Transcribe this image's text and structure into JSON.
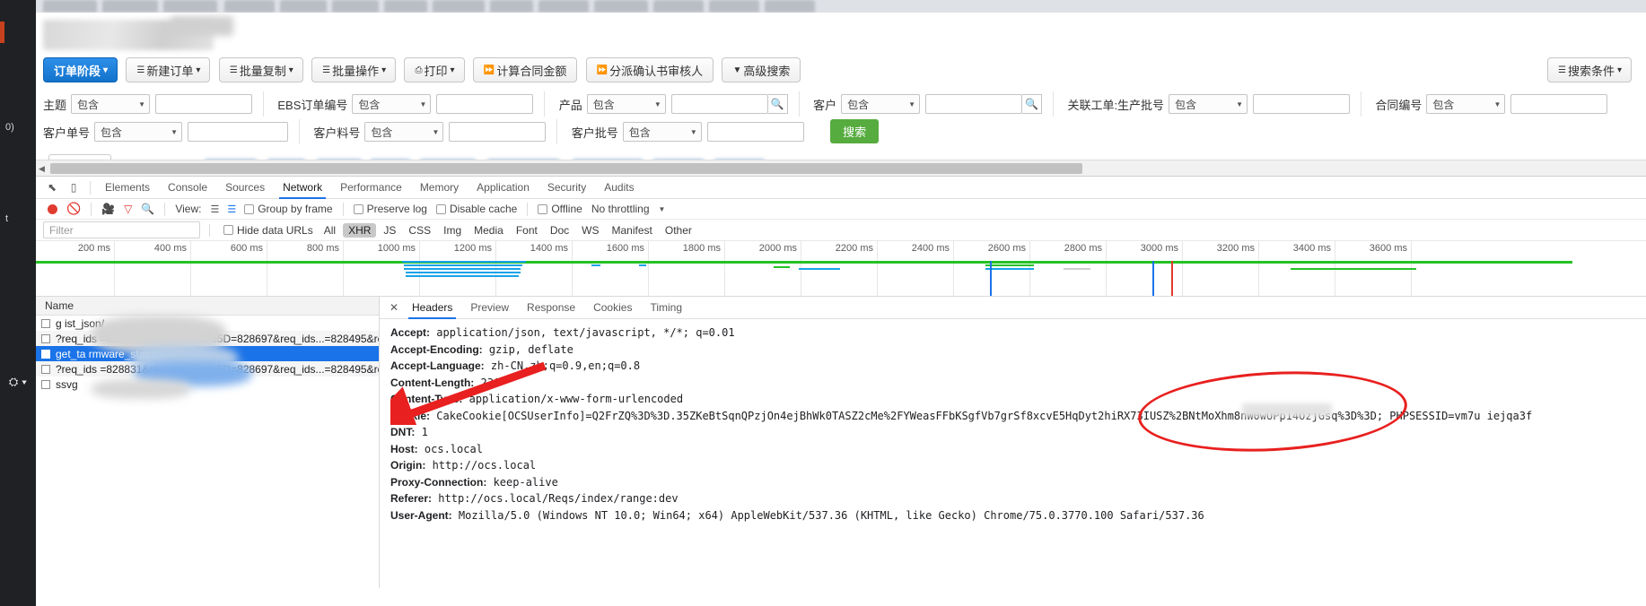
{
  "browser": {
    "tabs_blurred_count": 12
  },
  "app": {
    "toolbar_buttons": [
      {
        "label": "订单阶段",
        "icon": "chevron-down-icon",
        "primary": true
      },
      {
        "label": "新建订单",
        "icon": "list-icon",
        "primary": false
      },
      {
        "label": "批量复制",
        "icon": "list-icon",
        "primary": false
      },
      {
        "label": "批量操作",
        "icon": "list-icon",
        "primary": false
      },
      {
        "label": "打印",
        "icon": "printer-icon",
        "primary": false
      },
      {
        "label": "计算合同金额",
        "icon": "double-chevron-icon",
        "primary": false
      },
      {
        "label": "分派确认书审核人",
        "icon": "double-chevron-icon",
        "primary": false
      },
      {
        "label": "高级搜索",
        "icon": "funnel-icon",
        "primary": false
      }
    ],
    "search_conditions_label": "搜索条件",
    "search_button_label": "搜索",
    "filter_row_1": [
      {
        "label": "主题",
        "operator": "包含",
        "value": "",
        "has_magnifier": false
      },
      {
        "label": "EBS订单编号",
        "operator": "包含",
        "value": "",
        "has_magnifier": false
      },
      {
        "label": "产品",
        "operator": "包含",
        "value": "",
        "has_magnifier": true
      },
      {
        "label": "客户",
        "operator": "包含",
        "value": "",
        "has_magnifier": true
      },
      {
        "label": "关联工单:生产批号",
        "operator": "包含",
        "value": "",
        "has_magnifier": false
      },
      {
        "label": "合同编号",
        "operator": "包含",
        "value": "",
        "has_magnifier": false
      }
    ],
    "filter_row_2": [
      {
        "label": "客户单号",
        "operator": "包含",
        "value": ""
      },
      {
        "label": "客户料号",
        "operator": "包含",
        "value": ""
      },
      {
        "label": "客户批号",
        "operator": "包含",
        "value": ""
      }
    ]
  },
  "devtools": {
    "panels": [
      "Elements",
      "Console",
      "Sources",
      "Network",
      "Performance",
      "Memory",
      "Application",
      "Security",
      "Audits"
    ],
    "active_panel": "Network",
    "network_toolbar": {
      "view_label": "View:",
      "group_by_frame": "Group by frame",
      "preserve_log": "Preserve log",
      "disable_cache": "Disable cache",
      "offline": "Offline",
      "throttling": "No throttling"
    },
    "filter_bar": {
      "filter_placeholder": "Filter",
      "hide_data_urls": "Hide data URLs",
      "types": [
        "All",
        "XHR",
        "JS",
        "CSS",
        "Img",
        "Media",
        "Font",
        "Doc",
        "WS",
        "Manifest",
        "Other"
      ],
      "selected_type": "XHR"
    },
    "overview": {
      "ticks": [
        "200 ms",
        "400 ms",
        "600 ms",
        "800 ms",
        "1000 ms",
        "1200 ms",
        "1400 ms",
        "1600 ms",
        "1800 ms",
        "2000 ms",
        "2200 ms",
        "2400 ms",
        "2600 ms",
        "2800 ms",
        "3000 ms",
        "3200 ms",
        "3400 ms",
        "3600 ms"
      ]
    },
    "requests": {
      "column_header": "Name",
      "rows": [
        {
          "name": "g                    ist_json/",
          "selected": false,
          "blurred": true
        },
        {
          "name": "?req_ids                 =828831&req_ids%5B%5D=828697&req_ids...=828495&re...",
          "selected": false,
          "blurred": true
        },
        {
          "name": "get_ta              rmware_status/",
          "selected": true,
          "blurred": true
        },
        {
          "name": "?req_ids                 =828831&req_ids%5B%5D=828697&req_ids...=828495&re...",
          "selected": false,
          "blurred": true
        },
        {
          "name": "                   ssvg",
          "selected": false,
          "blurred": true
        }
      ]
    },
    "detail": {
      "tabs": [
        "Headers",
        "Preview",
        "Response",
        "Cookies",
        "Timing"
      ],
      "active_tab": "Headers",
      "headers": [
        {
          "key": "Accept:",
          "value": "application/json, text/javascript, */*; q=0.01"
        },
        {
          "key": "Accept-Encoding:",
          "value": "gzip, deflate"
        },
        {
          "key": "Accept-Language:",
          "value": "zh-CN,zh;q=0.9,en;q=0.8"
        },
        {
          "key": "Content-Length:",
          "value": "236"
        },
        {
          "key": "Content-Type:",
          "value": "application/x-www-form-urlencoded"
        },
        {
          "key": "Cookie:",
          "value": "CakeCookie[OCSUserInfo]=Q2FrZQ%3D%3D.35ZKeBtSqnQPzjOn4ejBhWk0TASZ2cMe%2FYWeasFFbKSgfVb7grSf8xcvE5HqDyt2hiRX73IUSZ%2BNtMoXhm8nW0wUPp14OzjGsq%3D%3D; PHPSESSID=vm7u                    iejqa3f"
        },
        {
          "key": "DNT:",
          "value": "1"
        },
        {
          "key": "Host:",
          "value": "ocs.local"
        },
        {
          "key": "Origin:",
          "value": "http://ocs.local"
        },
        {
          "key": "Proxy-Connection:",
          "value": "keep-alive"
        },
        {
          "key": "Referer:",
          "value": "http://ocs.local/Reqs/index/range:dev"
        },
        {
          "key": "User-Agent:",
          "value": "Mozilla/5.0 (Windows NT 10.0; Win64; x64) AppleWebKit/537.36 (KHTML, like Gecko) Chrome/75.0.3770.100 Safari/537.36"
        }
      ]
    }
  },
  "annotations": {
    "arrow_color": "#e8201f",
    "ellipse_color": "#e8201f"
  },
  "colors": {
    "accent_blue": "#1a73e8",
    "primary_button": "#1272cc",
    "search_green": "#57ac3f",
    "record_red": "#e03b2f"
  }
}
